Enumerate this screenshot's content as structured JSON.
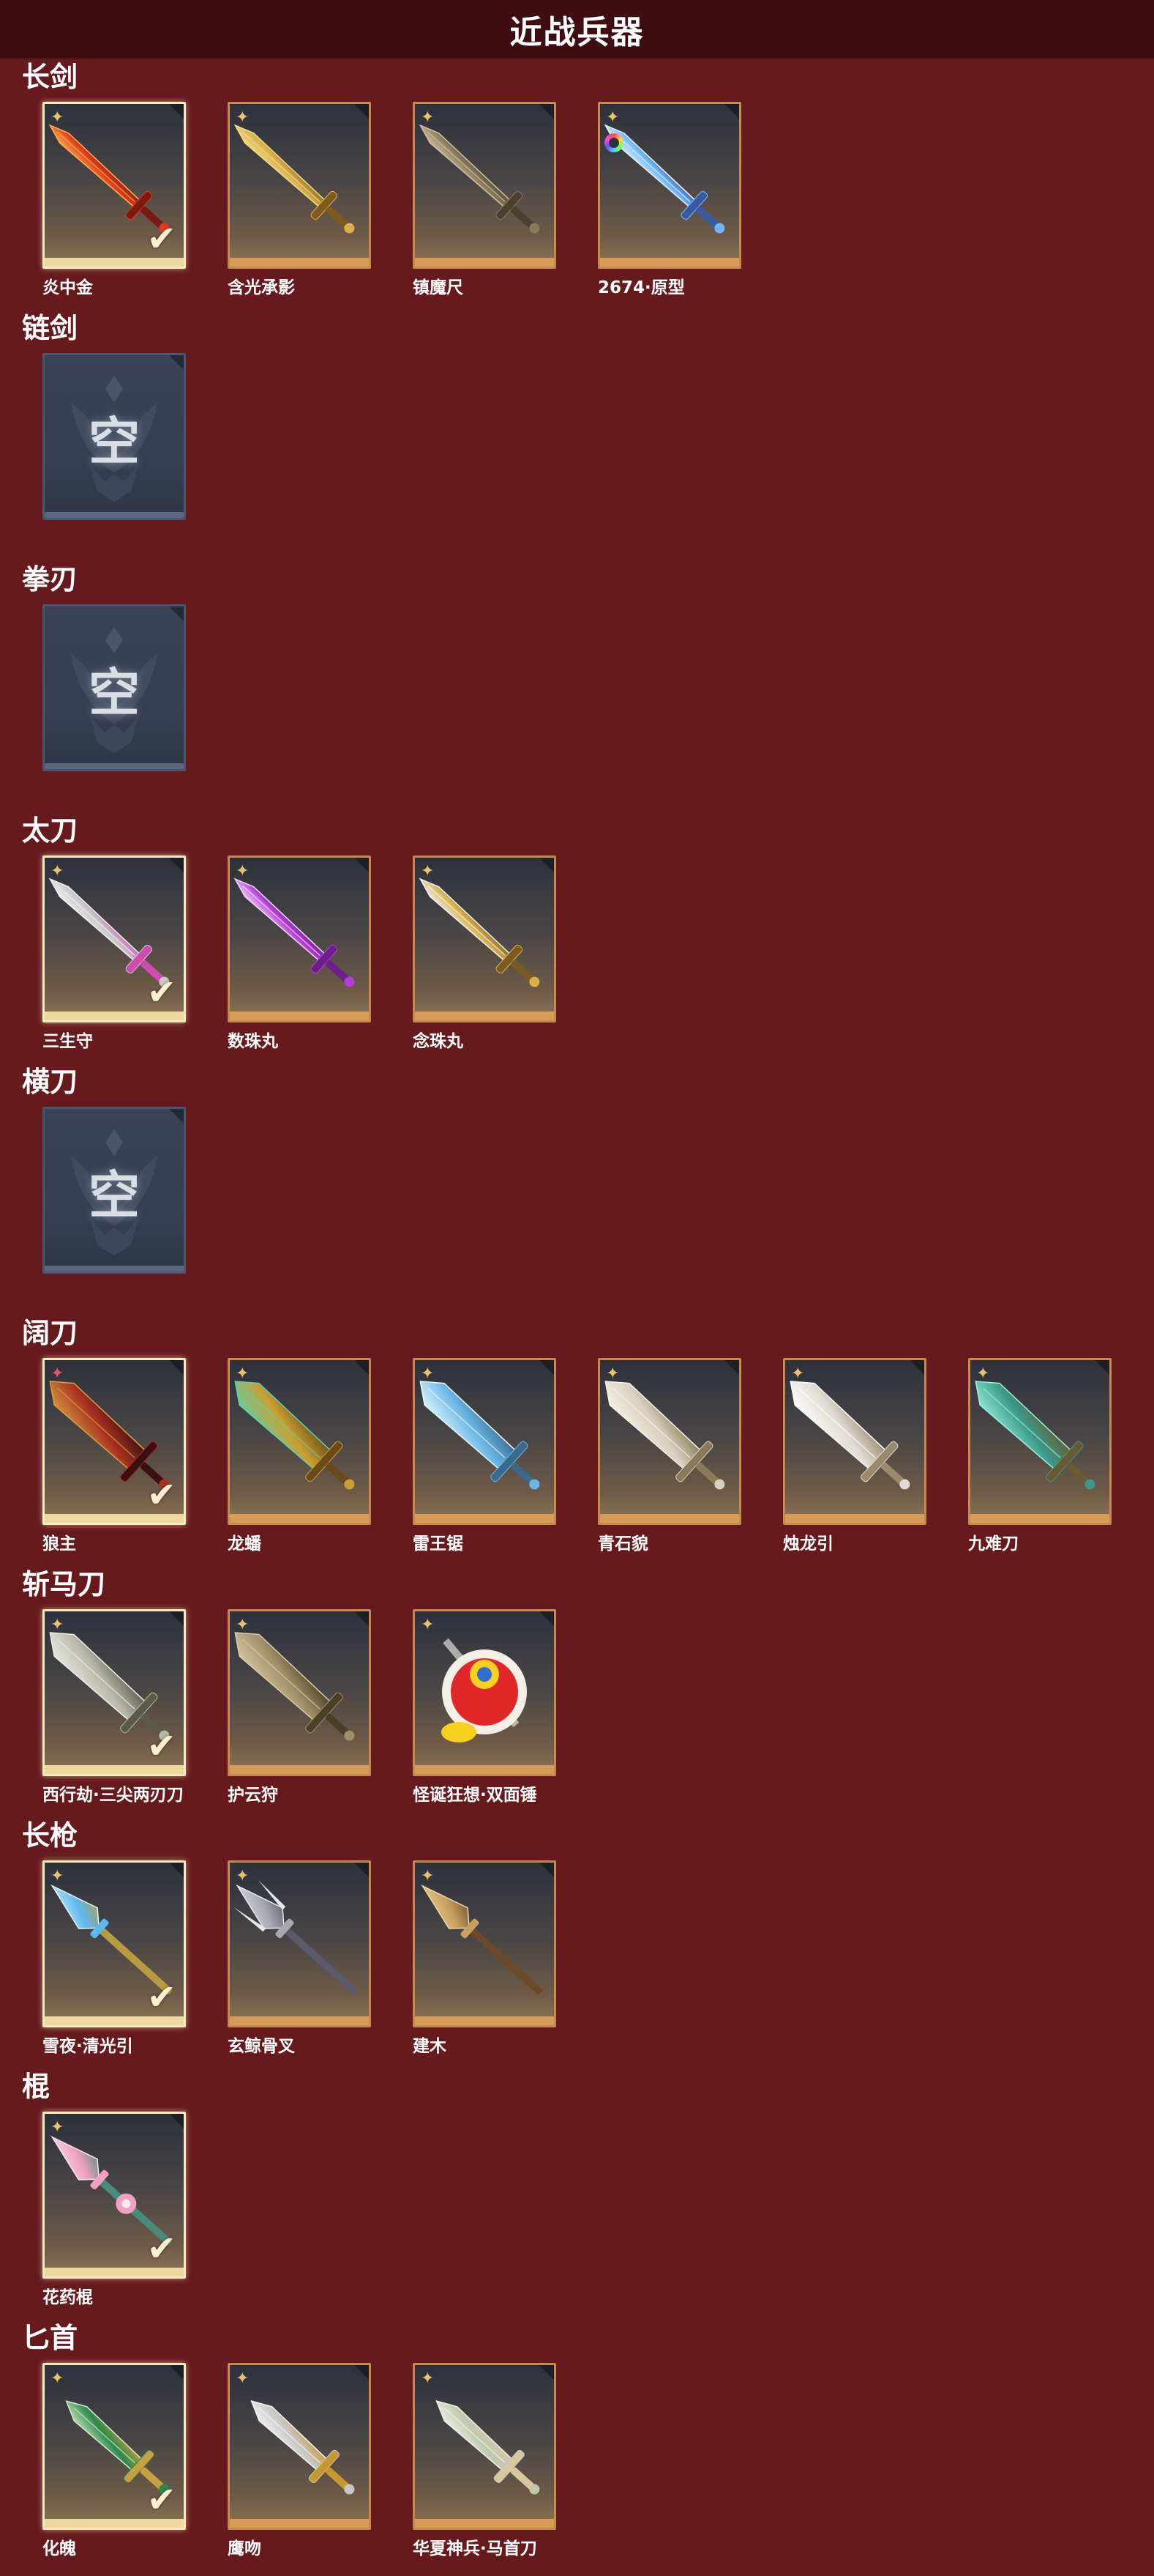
{
  "window": {
    "title": "近战兵器"
  },
  "colors": {
    "background": "#661a1e",
    "header": "#3e0e11",
    "tile_border": "#c48a4e",
    "selected_border": "#f6ebbe"
  },
  "categories": [
    {
      "title": "长剑",
      "items": [
        {
          "name": "炎中金",
          "selected": true,
          "badge": "star",
          "icon": "red-flame-sword",
          "colors": [
            "#e03a1e",
            "#ffb24a",
            "#7a1a10"
          ]
        },
        {
          "name": "含光承影",
          "selected": false,
          "badge": "star",
          "icon": "golden-sword",
          "colors": [
            "#d8b24c",
            "#f3dc86",
            "#7d5a1e"
          ]
        },
        {
          "name": "镇魔尺",
          "selected": false,
          "badge": "star",
          "icon": "bronze-sword",
          "colors": [
            "#8a7a5a",
            "#cfc2a0",
            "#4a4030"
          ]
        },
        {
          "name": "2674·原型",
          "selected": false,
          "badge": "star",
          "rainbow": true,
          "icon": "light-saber",
          "colors": [
            "#6fb8ff",
            "#e8f6ff",
            "#3a5aa0"
          ]
        }
      ]
    },
    {
      "title": "链剑",
      "items": [
        {
          "empty": true,
          "placeholder": "空"
        }
      ]
    },
    {
      "title": "拳刃",
      "items": [
        {
          "empty": true,
          "placeholder": "空"
        }
      ]
    },
    {
      "title": "太刀",
      "items": [
        {
          "name": "三生守",
          "selected": true,
          "badge": "star",
          "icon": "silver-katana",
          "colors": [
            "#c8c8c8",
            "#f0f0f0",
            "#d04ab0"
          ]
        },
        {
          "name": "数珠丸",
          "selected": false,
          "badge": "star",
          "icon": "purple-katana",
          "colors": [
            "#b43cd8",
            "#f6d9ff",
            "#6c1f8a"
          ]
        },
        {
          "name": "念珠丸",
          "selected": false,
          "badge": "star",
          "icon": "white-gold-katana",
          "colors": [
            "#d9b048",
            "#f2f2f2",
            "#7a5a20"
          ]
        }
      ]
    },
    {
      "title": "横刀",
      "items": [
        {
          "empty": true,
          "placeholder": "空"
        }
      ]
    },
    {
      "title": "阔刀",
      "items": [
        {
          "name": "狼主",
          "selected": true,
          "badge": "star-red",
          "icon": "dark-broadsword",
          "colors": [
            "#a83020",
            "#d8a040",
            "#3a1010"
          ]
        },
        {
          "name": "龙蟠",
          "selected": false,
          "badge": "star",
          "icon": "gold-teal-broadsword",
          "colors": [
            "#c8a030",
            "#5fd0b0",
            "#6a4a18"
          ]
        },
        {
          "name": "雷王锯",
          "selected": false,
          "badge": "star",
          "icon": "lightning-broadsword",
          "colors": [
            "#6ab8e8",
            "#e8f8ff",
            "#3a6a8a"
          ]
        },
        {
          "name": "青石貌",
          "selected": false,
          "badge": "star",
          "icon": "white-dragon-broadsword",
          "colors": [
            "#d8d0c0",
            "#f8f4e8",
            "#8a7a5a"
          ]
        },
        {
          "name": "烛龙引",
          "selected": false,
          "badge": "star",
          "icon": "white-broadsword",
          "colors": [
            "#e0dcd4",
            "#ffffff",
            "#9a8a6a"
          ]
        },
        {
          "name": "九难刀",
          "selected": false,
          "badge": "star",
          "icon": "jade-broadsword",
          "colors": [
            "#3a9a8a",
            "#9af0d8",
            "#6a5a30"
          ]
        }
      ]
    },
    {
      "title": "斩马刀",
      "items": [
        {
          "name": "西行劫·三尖两刃刀",
          "selected": true,
          "badge": "star",
          "icon": "silver-glaive",
          "colors": [
            "#b8b8a8",
            "#eeeeea",
            "#5a5a4a"
          ]
        },
        {
          "name": "护云狩",
          "selected": false,
          "badge": "star",
          "icon": "bronze-glaive",
          "colors": [
            "#a09068",
            "#d8ccaa",
            "#4a4028"
          ]
        },
        {
          "name": "怪诞狂想·双面锤",
          "selected": false,
          "badge": "star",
          "icon": "clown-hammer",
          "colors": [
            "#e02828",
            "#f8d020",
            "#f8f8f0"
          ]
        }
      ]
    },
    {
      "title": "长枪",
      "items": [
        {
          "name": "雪夜·清光引",
          "selected": true,
          "badge": "star",
          "icon": "ice-spear",
          "colors": [
            "#5ab8f0",
            "#e8f8ff",
            "#b89a40"
          ]
        },
        {
          "name": "玄鲸骨叉",
          "selected": false,
          "badge": "star",
          "icon": "trident",
          "colors": [
            "#a8a8b0",
            "#e8e8f0",
            "#5a5a6a"
          ]
        },
        {
          "name": "建木",
          "selected": false,
          "badge": "star",
          "icon": "wood-spear",
          "colors": [
            "#c8a060",
            "#f0d8a0",
            "#6a4a28"
          ]
        }
      ]
    },
    {
      "title": "棍",
      "items": [
        {
          "name": "花药棍",
          "selected": true,
          "badge": "star",
          "icon": "flower-staff",
          "colors": [
            "#f0a0c0",
            "#ffe8f0",
            "#4a8a7a"
          ]
        }
      ]
    },
    {
      "title": "匕首",
      "items": [
        {
          "name": "化魄",
          "selected": true,
          "badge": "star",
          "icon": "curved-dagger",
          "colors": [
            "#2a8a4a",
            "#d8e8c8",
            "#c8a040"
          ]
        },
        {
          "name": "鹰吻",
          "selected": false,
          "badge": "star",
          "icon": "kris-dagger",
          "colors": [
            "#c8c8c8",
            "#f4f4f4",
            "#c89830"
          ]
        },
        {
          "name": "华夏神兵·马首刀",
          "selected": false,
          "badge": "star",
          "icon": "horse-head-dagger",
          "colors": [
            "#c0c8b0",
            "#f0f4e8",
            "#d8c8a0"
          ]
        }
      ]
    }
  ]
}
